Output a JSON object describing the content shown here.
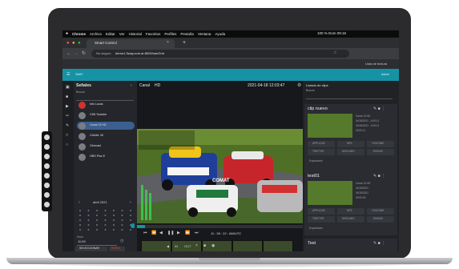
{
  "browser": {
    "menu_items": [
      "Chrome",
      "Archivo",
      "Editar",
      "Ver",
      "Historial",
      "Favoritos",
      "Perfiles",
      "Pestaña",
      "Ventana",
      "Ayuda"
    ],
    "clock": "100 %   Dom 09:16",
    "tab_title": "Smart Control",
    "url_security": "No seguro",
    "url": "demo1.3way.com.ar:8000/navGrid",
    "reading_list": "Lista de lectura"
  },
  "app": {
    "header_left": "3WAY",
    "header_right": "Admin"
  },
  "left_panel": {
    "title": "Señales",
    "search_label": "Buscar",
    "channels": [
      {
        "label": "Info Lucas"
      },
      {
        "label": "C5N Youtube"
      },
      {
        "label": "Canal 13 HD"
      },
      {
        "label": "CANAL 26"
      },
      {
        "label": "Cinecast"
      },
      {
        "label": "HBO Plus E"
      }
    ],
    "calendar_month": "abril 2021",
    "time_label": "Hora",
    "time_value": "11:59",
    "select_button": "SELECCIONAR",
    "reset_button": "RESET"
  },
  "center_panel": {
    "channel_label": "Canal",
    "channel_quality": "HD",
    "timestamp": "2021-04-18 12:03:47",
    "sponsor_text": "COMAT",
    "transport_time": "11 : 59 :  22  :  AM/UTC",
    "mark_in": "IN",
    "mark_out": "OUT"
  },
  "right_panel": {
    "title": "Listado de clips",
    "search_label": "Buscar",
    "clips": [
      {
        "name": "clip nuevo",
        "meta": [
          "Canal 13 HD",
          "04/18/2021 - 4:00:11",
          "04/18/2021 - 4:00:11",
          "00:00:11"
        ],
        "buttons": [
          "APPLICAR",
          "MP4",
          "YOUTUBE",
          "TWITTER",
          "DESCARG",
          "ENVIAR"
        ],
        "export_label": "Exportación"
      },
      {
        "name": "test01",
        "meta": [
          "Canal 13 HD",
          "04/18/2021",
          "04/18/2021",
          "00:00:09"
        ],
        "buttons": [
          "APPLICAR",
          "MP4",
          "YOUTUBE",
          "TWITTER",
          "DESCARG",
          "ENVIAR"
        ],
        "export_label": "Exportación"
      },
      {
        "name": "Test"
      }
    ]
  },
  "colors": {
    "accent_teal": "#1593a4",
    "active_channel": "#3c5f8f",
    "record_red": "#d0342c"
  }
}
